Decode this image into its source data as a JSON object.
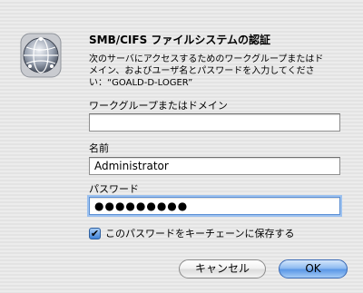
{
  "dialog": {
    "title": "SMB/CIFS ファイルシステムの認証",
    "message_line1": "次のサーバにアクセスするためのワークグループまたはド",
    "message_line2": "メイン、およびユーザ名とパスワードを入力してくださ",
    "message_line3": "い：“GOALD-D-LOGER”",
    "app_icon": "network-globe-icon"
  },
  "fields": {
    "workgroup": {
      "label": "ワークグループまたはドメイン",
      "value": ""
    },
    "name": {
      "label": "名前",
      "value": "Administrator"
    },
    "password": {
      "label": "パスワード",
      "value": "●●●●●●●●●"
    }
  },
  "remember": {
    "label": "このパスワードをキーチェーンに保存する",
    "checked": true
  },
  "buttons": {
    "cancel_label": "キャンセル",
    "ok_label": "OK"
  },
  "colors": {
    "accent": "#5b97e6",
    "focus_ring": "#9cc1ef"
  }
}
